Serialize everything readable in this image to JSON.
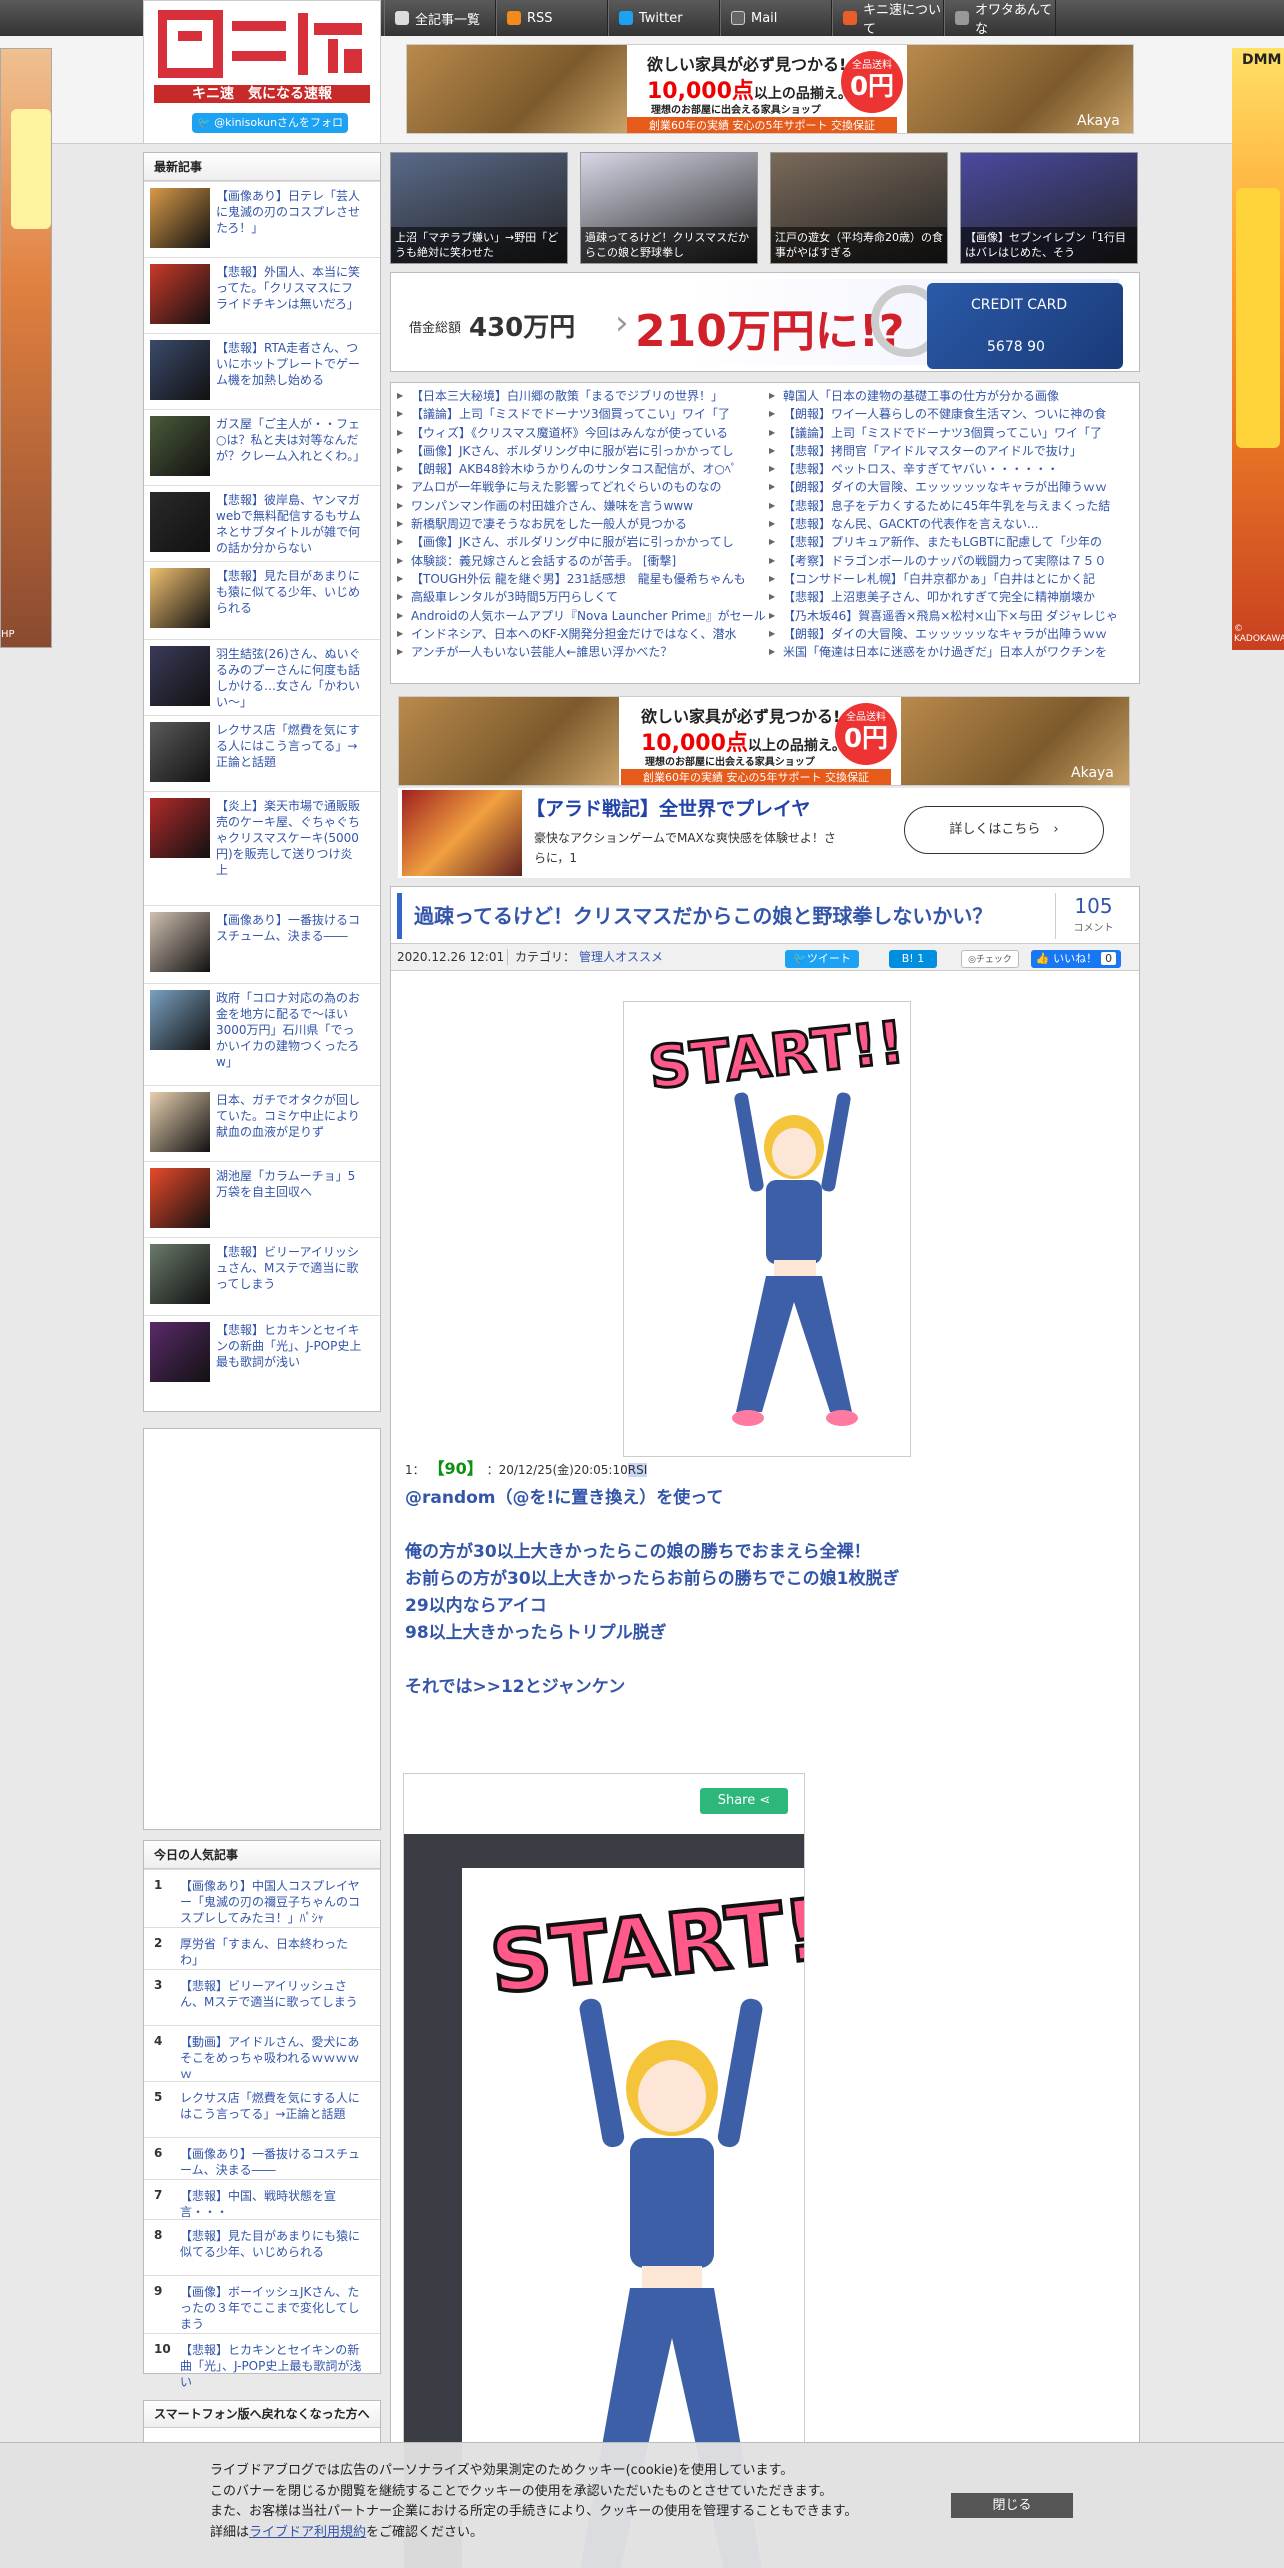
{
  "nav": {
    "items": [
      {
        "label": "全記事一覧",
        "icon": "list-icon"
      },
      {
        "label": "RSS",
        "icon": "rss-icon"
      },
      {
        "label": "Twitter",
        "icon": "twitter-icon"
      },
      {
        "label": "Mail",
        "icon": "mail-icon"
      },
      {
        "label": "キニ速について",
        "icon": "info-icon"
      },
      {
        "label": "オワタあんてな",
        "icon": "antenna-icon"
      }
    ]
  },
  "logo": {
    "glyphs": "キニ速",
    "subtitle": "キニ速　気になる速報",
    "follow": "@kinisokunさんをフォロー"
  },
  "ad_furniture": {
    "line1": "欲しい家具が必ず見つかる!",
    "line2_num": "10,000点",
    "line2_rest": "以上の品揃え。",
    "line3": "理想のお部屋に出会える家具ショップ",
    "circle_top": "全品送料",
    "circle_big": "0円",
    "bar": "創業60年の実績 安心の5年サポート 交換保証",
    "brand": "Akaya"
  },
  "ad_debt": {
    "label": "借金総額",
    "from": "430万円",
    "to": "210万円に!?",
    "card": "CREDIT CARD",
    "card_num": "5678 90"
  },
  "ad_game": {
    "title": "【アラド戦記】全世界でプレイヤ",
    "desc": "豪快なアクションゲームでMAXな爽快感を体験せよ！さらに，1",
    "button": "詳しくはこちら"
  },
  "sidebar_recent": {
    "heading": "最新記事",
    "items": [
      "【画像あり】日テレ「芸人に鬼滅の刃のコスプレさせたろ！」",
      "【悲報】外国人、本当に笑ってた。「クリスマスにフライドチキンは無いだろ」",
      "【悲報】RTA走者さん、ついにホットプレートでゲーム機を加熱し始める",
      "ガス屋「ご主人が・・フェ○は？私と夫は対等なんだが？クレーム入れとくわ。」",
      "【悲報】彼岸島、ヤンマガwebで無料配信するもサムネとサブタイトルが雑で何の話か分からない",
      "【悲報】見た目があまりにも猿に似てる少年、いじめられる",
      "羽生結弦(26)さん、ぬいぐるみのプーさんに何度も話しかける…女さん「かわいい～」",
      "レクサス店「燃費を気にする人にはこう言ってる」→正論と話題",
      "【炎上】楽天市場で通販販売のケーキ屋、ぐちゃぐちゃクリスマスケーキ(5000円)を販売して送りつけ炎上",
      "【画像あり】一番抜けるコスチューム、決まる――",
      "政府「コロナ対応の為のお金を地方に配るで～ほい3000万円」石川県「でっかいイカの建物つくったろw」",
      "日本、ガチでオタクが回していた。コミケ中止により献血の血液が足りず",
      "湖池屋「カラムーチョ」5万袋を自主回収へ",
      "【悲報】ビリーアイリッシュさん、Mステで適当に歌ってしまう",
      "【悲報】ヒカキンとセイキンの新曲「光」、J-POP史上最も歌詞が浅い"
    ]
  },
  "sidebar_popular": {
    "heading": "今日の人気記事",
    "items": [
      {
        "num": "1",
        "text": "【画像あり】中国人コスプレイヤー「鬼滅の刃の禰豆子ちゃんのコスプレしてみたヨ！」ﾊﾟｼｬ"
      },
      {
        "num": "2",
        "text": "厚労省「すまん、日本終わったわ」"
      },
      {
        "num": "3",
        "text": "【悲報】ビリーアイリッシュさん、Mステで適当に歌ってしまう"
      },
      {
        "num": "4",
        "text": "【動画】アイドルさん、愛犬にあそこをめっちゃ吸われるｗｗｗｗｗ"
      },
      {
        "num": "5",
        "text": "レクサス店「燃費を気にする人にはこう言ってる」→正論と話題"
      },
      {
        "num": "6",
        "text": "【画像あり】一番抜けるコスチューム、決まる――"
      },
      {
        "num": "7",
        "text": "【悲報】中国、戦時状態を宣言・・・"
      },
      {
        "num": "8",
        "text": "【悲報】見た目があまりにも猿に似てる少年、いじめられる"
      },
      {
        "num": "9",
        "text": "【画像】ボーイッシュJKさん、たったの３年でここまで変化してしまう"
      },
      {
        "num": "10",
        "text": "【悲報】ヒカキンとセイキンの新曲「光」、J-POP史上最も歌詞が浅い"
      }
    ]
  },
  "sidebar_smartphone": {
    "heading": "スマートフォン版へ戻れなくなった方へ"
  },
  "thumbs": [
    "上沼「マヂラブ嫌い」→野田「どうも絶対に笑わせた",
    "過疎ってるけど！クリスマスだからこの娘と野球拳し",
    "江戸の遊女（平均寿命20歳）の食事がやばすぎる",
    "【画像】セブンイレブン「1行目はバレはじめた、そう"
  ],
  "links_left": [
    "【日本三大秘境】白川郷の散策「まるでジブリの世界！」",
    "【議論】上司「ミスドでドーナツ3個買ってこい」ワイ「了",
    "【ウィズ】《クリスマス魔道杯》今回はみんなが使っている",
    "【画像】JKさん、ボルダリング中に服が岩に引っかかってし",
    "【朗報】AKB48鈴木ゆうかりんのサンタコス配信が、オ○ﾍﾟ",
    "アムロが一年戦争に与えた影響ってどれぐらいのものなの",
    "ワンパンマン作画の村田雄介さん、嫌味を言うwww",
    "新橋駅周辺で凄そうなお尻をした一般人が見つかる",
    "【画像】JKさん、ボルダリング中に服が岩に引っかかってし",
    "体験談：義兄嫁さんと会話するのが苦手。 [衝撃]",
    "【TOUGH外伝 龍を継ぐ男】231話感想　龍星も優希ちゃんも",
    "高級車レンタルが3時間5万円らしくて",
    "Androidの人気ホームアプリ『Nova Launcher Prime』がセール",
    "インドネシア、日本へのKF-X開発分担金だけではなく、潜水",
    "アンチが一人もいない芸能人←誰思い浮かべた？"
  ],
  "links_right": [
    "韓国人「日本の建物の基礎工事の仕方が分かる画像",
    "【朗報】ワイ一人暮らしの不健康食生活マン、ついに神の食",
    "【議論】上司「ミスドでドーナツ3個買ってこい」ワイ「了",
    "【悲報】拷問官「アイドルマスターのアイドルで抜け」",
    "【悲報】ペットロス、辛すぎてヤバい・・・・・・",
    "【朗報】ダイの大冒険、エッッッッッなキャラが出陣うｗｗ",
    "【悲報】息子をデカくするために45年牛乳を与えまくった結",
    "【悲報】なん民、GACKTの代表作を言えない...",
    "【悲報】プリキュア新作、またもLGBTに配慮して「少年の",
    "【考察】ドラゴンボールのナッパの戦闘力って実際は７５０",
    "【コンサドーレ札幌】「白井京都かぁ」「白井はとにかく記",
    "【悲報】上沼恵美子さん、叩かれすぎて完全に精神崩壊か",
    "【乃木坂46】賀喜遥香×飛鳥×松村×山下×与田 ダジャレじゃ",
    "【朗報】ダイの大冒険、エッッッッッなキャラが出陣うｗｗ",
    "米国「俺達は日本に迷惑をかけ過ぎだ」日本人がワクチンを"
  ],
  "article": {
    "title": "過疎ってるけど！クリスマスだからこの娘と野球拳しないかい？",
    "comment_count": "105",
    "comment_label": "コメント",
    "date": "2020.12.26 12:01",
    "category_label": "カテゴリ：",
    "category": "管理人オススメ",
    "tweet": "ツイート",
    "hatena_count": "1",
    "check": "チェック",
    "like": "いいね！",
    "like_count": "0",
    "image_word": "START!!",
    "post_index": "1：",
    "post_num": "【90】",
    "post_time": "：20/12/25(金)20:05:10",
    "post_id": "RSI",
    "lines": [
      "@random（@を!に置き換え）を使って",
      "",
      "俺の方が30以上大きかったらこの娘の勝ちでおまえら全裸！",
      "お前らの方が30以上大きかったらお前らの勝ちでこの娘1枚脱ぎ",
      "29以内ならアイコ",
      "98以上大きかったらトリプル脱ぎ",
      "",
      "それでは>>12とジャンケン"
    ],
    "share_label": "Share"
  },
  "cookie": {
    "line1": "ライブドアブログでは広告のパーソナライズや効果測定のためクッキー(cookie)を使用しています。",
    "line2": "このバナーを閉じるか閲覧を継続することでクッキーの使用を承認いただいたものとさせていただきます。",
    "line3": "また、お客様は当社パートナー企業における所定の手続きにより、クッキーの使用を管理することもできます。",
    "line4_pre": "詳細は",
    "line4_link": "ライブドア利用規約",
    "line4_post": "をご確認ください。",
    "close": "閉じる"
  },
  "side_ads": {
    "left_bottom": "HP",
    "right_top": "DMM",
    "right_bottom": "© KADOKAWA"
  }
}
